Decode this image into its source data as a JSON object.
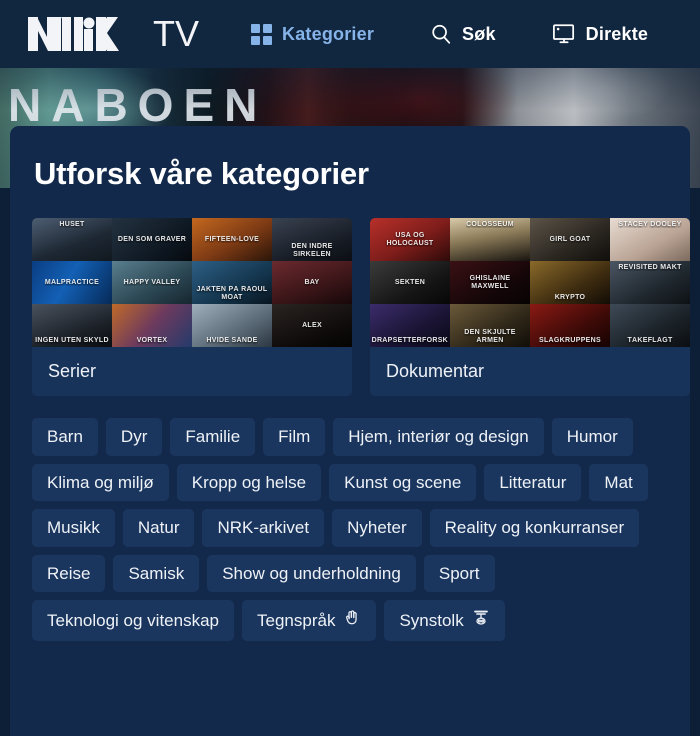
{
  "header": {
    "logo": {
      "mark": "NRK",
      "word": "TV",
      "icon_name": "nrk-logo"
    },
    "nav": [
      {
        "label": "Kategorier",
        "icon": "grid-icon",
        "active": true
      },
      {
        "label": "Søk",
        "icon": "search-icon",
        "active": false
      },
      {
        "label": "Direkte",
        "icon": "live-tv-icon",
        "active": false
      }
    ]
  },
  "hero": {
    "title": "NABOEN"
  },
  "panel": {
    "heading": "Utforsk våre kategorier",
    "feature_cards": [
      {
        "label": "Serier",
        "thumbs": [
          {
            "title": "HUSET",
            "pos": "tt",
            "bg": "linear-gradient(160deg,#4d5e72,#1d2733 60%,#11181f)"
          },
          {
            "title": "DEN SOM GRAVER",
            "pos": "tc",
            "bg": "linear-gradient(140deg,#233240,#0d1620 70%,#060a0e)"
          },
          {
            "title": "FIFTEEN-LOVE",
            "pos": "tc",
            "bg": "linear-gradient(150deg,#c4681f,#7d3a14 55%,#2a1509)"
          },
          {
            "title": "DEN INDRE SIRKELEN",
            "pos": "tb",
            "bg": "linear-gradient(160deg,#3a4250,#171c25 65%,#0b0e13)"
          },
          {
            "title": "MALPRACTICE",
            "pos": "tc",
            "bg": "linear-gradient(120deg,#0a3d82,#1360b5 45%,#062a58)"
          },
          {
            "title": "HAPPY VALLEY",
            "pos": "tc",
            "bg": "linear-gradient(150deg,#5a7f8e,#2b4653 60%,#16262f)"
          },
          {
            "title": "JAKTEN PÅ RAOUL MOAT",
            "pos": "tb",
            "bg": "linear-gradient(150deg,#2d5f85,#123249 65%,#08141e)"
          },
          {
            "title": "BAY",
            "pos": "tc",
            "bg": "linear-gradient(160deg,#6b2a2e,#3a1518 60%,#170809)"
          },
          {
            "title": "INGEN UTEN SKYLD",
            "pos": "tb",
            "bg": "linear-gradient(160deg,#49525e,#1b2027 65%,#0a0d11)"
          },
          {
            "title": "VORTEX",
            "pos": "tb",
            "bg": "linear-gradient(130deg,#c06a28,#6d3a5e 50%,#243a6b)"
          },
          {
            "title": "HVIDE SANDE",
            "pos": "tb",
            "bg": "linear-gradient(150deg,#9fb0bd,#5b6a77 60%,#2b3742)"
          },
          {
            "title": "ALEX",
            "pos": "tc",
            "bg": "linear-gradient(160deg,#2a2422,#0d0a09 70%,#050403)"
          }
        ]
      },
      {
        "label": "Dokumentar",
        "thumbs": [
          {
            "title": "USA OG HOLOCAUST",
            "pos": "tc",
            "bg": "linear-gradient(150deg,#b8302a,#7d1d1a 55%,#2d0a09)"
          },
          {
            "title": "COLOSSEUM",
            "pos": "tt",
            "bg": "linear-gradient(170deg,#d8c9a8,#8a7a58 45%,#18140f)"
          },
          {
            "title": "GIRL GOAT",
            "pos": "tc",
            "bg": "linear-gradient(150deg,#5c5348,#2a2620 60%,#100e0b)"
          },
          {
            "title": "STACEY DOOLEY",
            "pos": "tt",
            "bg": "linear-gradient(150deg,#e8dcd2,#b9a394 60%,#7c6a5e)"
          },
          {
            "title": "SEKTEN",
            "pos": "tc",
            "bg": "linear-gradient(150deg,#3b3b3b,#141414 65%,#070707)"
          },
          {
            "title": "GHISLAINE MAXWELL",
            "pos": "tc",
            "bg": "linear-gradient(150deg,#3a1014,#140608 65%,#070203)"
          },
          {
            "title": "KRYPTO",
            "pos": "tb",
            "bg": "linear-gradient(150deg,#8a6a2a,#3e2c10 60%,#120c05)"
          },
          {
            "title": "REVISITED MAKT",
            "pos": "tt",
            "bg": "linear-gradient(150deg,#4a5663,#20282f 60%,#0d1114)"
          },
          {
            "title": "DRAPSETTERFORSKNING",
            "pos": "tb",
            "bg": "linear-gradient(150deg,#3b2c6b,#1a1433 60%,#0a0818)"
          },
          {
            "title": "DEN SKJULTE ARMEN",
            "pos": "tb",
            "bg": "linear-gradient(150deg,#6b5a3a,#2f2718 60%,#110e08)"
          },
          {
            "title": "SLAGKRUPPENS",
            "pos": "tb",
            "bg": "linear-gradient(150deg,#8a1a14,#3d0a07 60%,#150303)"
          },
          {
            "title": "TÅKEFLAGT",
            "pos": "tb",
            "bg": "linear-gradient(150deg,#3e4a57,#1b2228 60%,#0b0e11)"
          }
        ]
      }
    ],
    "categories": [
      {
        "label": "Barn"
      },
      {
        "label": "Dyr"
      },
      {
        "label": "Familie"
      },
      {
        "label": "Film"
      },
      {
        "label": "Hjem, interiør og design"
      },
      {
        "label": "Humor"
      },
      {
        "label": "Klima og miljø"
      },
      {
        "label": "Kropp og helse"
      },
      {
        "label": "Kunst og scene"
      },
      {
        "label": "Litteratur"
      },
      {
        "label": "Mat"
      },
      {
        "label": "Musikk"
      },
      {
        "label": "Natur"
      },
      {
        "label": "NRK-arkivet"
      },
      {
        "label": "Nyheter"
      },
      {
        "label": "Reality og konkurranser"
      },
      {
        "label": "Reise"
      },
      {
        "label": "Samisk"
      },
      {
        "label": "Show og underholdning"
      },
      {
        "label": "Sport"
      },
      {
        "label": "Teknologi og vitenskap"
      },
      {
        "label": "Tegnspråk",
        "icon": "sign-language-icon"
      },
      {
        "label": "Synstolk",
        "icon": "audio-description-icon"
      }
    ]
  },
  "colors": {
    "page_bg": "#0d1f37",
    "topbar_bg": "#11263f",
    "panel_bg": "#13294b",
    "chip_bg": "#1b365e",
    "card_bg": "#18335a",
    "accent": "#86b3e8",
    "text": "#ffffff"
  }
}
